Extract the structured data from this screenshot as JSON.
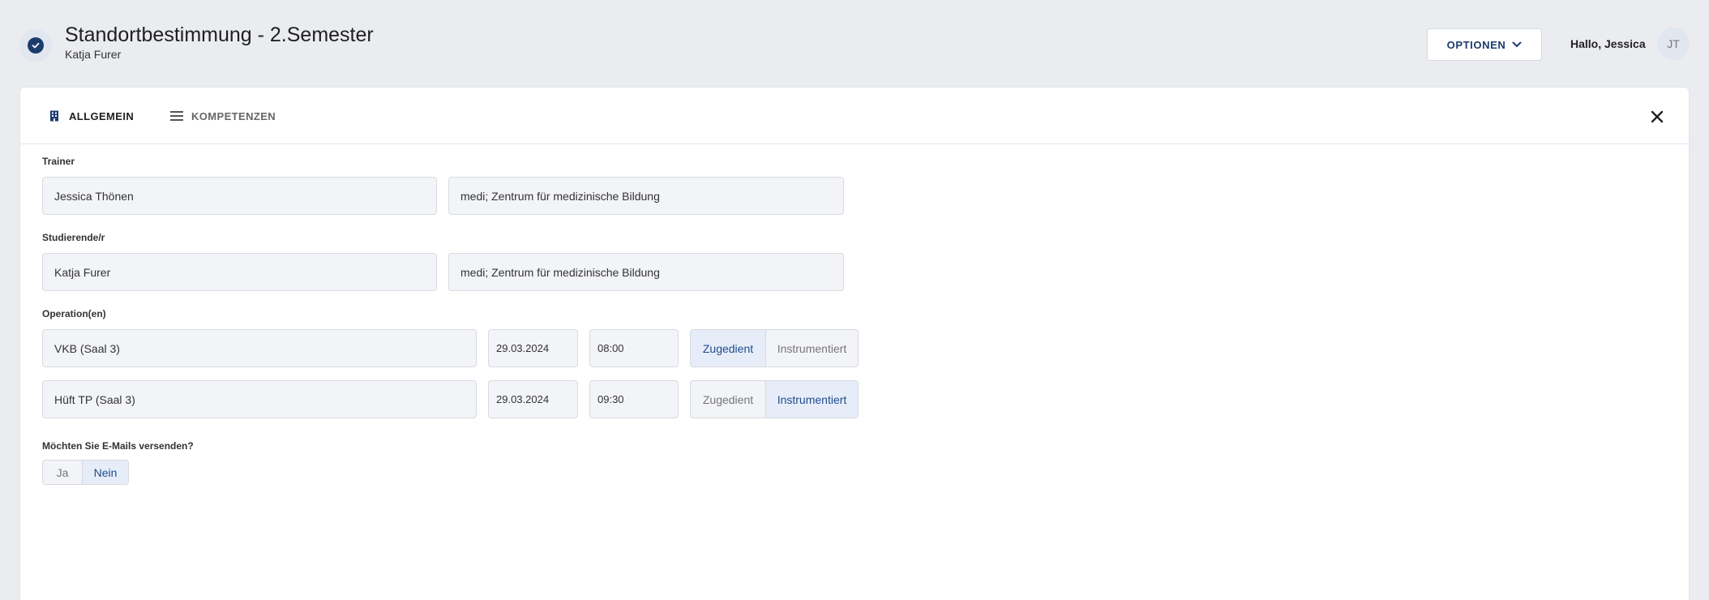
{
  "header": {
    "title": "Standortbestimmung - 2.Semester",
    "subtitle": "Katja Furer",
    "options_label": "OPTIONEN",
    "greeting": "Hallo, Jessica",
    "avatar_initials": "JT",
    "status_icon": "check-circle-icon"
  },
  "tabs": [
    {
      "label": "ALLGEMEIN",
      "icon": "building-icon",
      "active": true
    },
    {
      "label": "KOMPETENZEN",
      "icon": "list-icon",
      "active": false
    }
  ],
  "form": {
    "trainer": {
      "label": "Trainer",
      "name": "Jessica Thönen",
      "institution": "medi; Zentrum für medizinische Bildung"
    },
    "student": {
      "label": "Studierende/r",
      "name": "Katja Furer",
      "institution": "medi; Zentrum für medizinische Bildung"
    },
    "operations": {
      "label": "Operation(en)",
      "rows": [
        {
          "name": "VKB (Saal 3)",
          "date": "29.03.2024",
          "time": "08:00",
          "option_a": "Zugedient",
          "option_b": "Instrumentiert",
          "selected": "Zugedient"
        },
        {
          "name": "Hüft TP (Saal 3)",
          "date": "29.03.2024",
          "time": "09:30",
          "option_a": "Zugedient",
          "option_b": "Instrumentiert",
          "selected": "Instrumentiert"
        }
      ]
    },
    "email": {
      "label": "Möchten Sie E-Mails versenden?",
      "yes": "Ja",
      "no": "Nein",
      "selected": "Nein"
    }
  },
  "colors": {
    "background": "#ebecf0",
    "brand": "#1c3c6e",
    "active_segment": "#e7edf8"
  }
}
